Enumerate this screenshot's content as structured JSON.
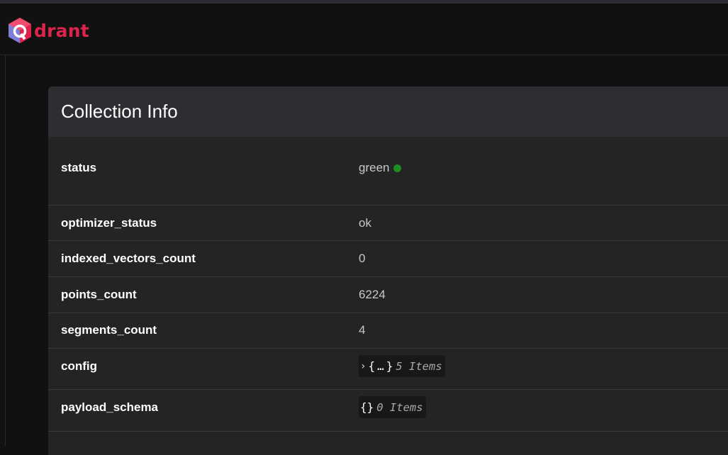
{
  "app": {
    "logo_text": "drant",
    "logo_icon": "qdrant-cube-icon",
    "brand_color": "#dc244c"
  },
  "card": {
    "title": "Collection Info"
  },
  "rows": {
    "status": {
      "key": "status",
      "value": "green",
      "indicator_color": "#1f8c1f"
    },
    "optimizer_status": {
      "key": "optimizer_status",
      "value": "ok"
    },
    "indexed_vectors_count": {
      "key": "indexed_vectors_count",
      "value": "0"
    },
    "points_count": {
      "key": "points_count",
      "value": "6224"
    },
    "segments_count": {
      "key": "segments_count",
      "value": "4"
    },
    "config": {
      "key": "config",
      "open_brace": "{",
      "ellipsis": "…",
      "close_brace": "}",
      "count_label": "5 Items",
      "expand_icon": "chevron-right-icon"
    },
    "payload_schema": {
      "key": "payload_schema",
      "braces": "{}",
      "count_label": "0 Items"
    }
  }
}
